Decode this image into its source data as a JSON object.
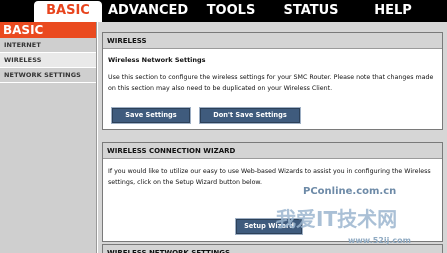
{
  "topnav": {
    "tabs": [
      {
        "label": "BASIC",
        "active": true
      },
      {
        "label": "ADVANCED",
        "active": false
      },
      {
        "label": "TOOLS",
        "active": false
      },
      {
        "label": "STATUS",
        "active": false
      },
      {
        "label": "HELP",
        "active": false
      }
    ]
  },
  "sidebar": {
    "title": "BASIC",
    "items": [
      {
        "label": "INTERNET",
        "selected": false
      },
      {
        "label": "WIRELESS",
        "selected": true
      },
      {
        "label": "NETWORK SETTINGS",
        "selected": false
      }
    ]
  },
  "wireless_panel": {
    "heading": "WIRELESS",
    "subheading": "Wireless Network Settings",
    "description": "Use this section to configure the wireless settings for your SMC Router. Please note that changes made on this section may also need to be duplicated on your Wireless Client.",
    "save_label": "Save Settings",
    "dont_save_label": "Don't Save Settings"
  },
  "wizard_panel": {
    "heading": "WIRELESS CONNECTION WIZARD",
    "description": "If you would like to utilize our easy to use Web-based Wizards to assist you in configuring the Wireless settings, click on the Setup Wizard button below.",
    "button_label": "Setup Wizard"
  },
  "network_panel": {
    "heading": "WIRELESS NETWORK SETTINGS"
  },
  "watermark": {
    "site": "PConline.com.cn",
    "chinese": "我爱IT技术网",
    "url": "www.52ij.com"
  },
  "colors": {
    "accent": "#ea4a1f",
    "nav_bg": "#000000",
    "button_bg": "#3f5b7d",
    "panel_head": "#d4d4d4"
  }
}
